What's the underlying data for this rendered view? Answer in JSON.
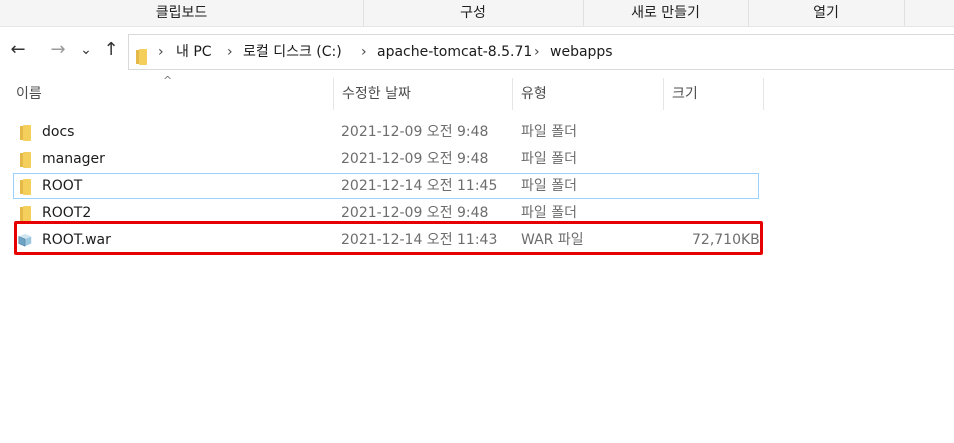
{
  "ribbon": {
    "groups": [
      "클립보드",
      "구성",
      "새로 만들기",
      "열기"
    ]
  },
  "nav": {
    "back_glyph": "←",
    "forward_glyph": "→",
    "history_glyph": "⌄",
    "up_glyph": "↑",
    "breadcrumb": [
      "내 PC",
      "로컬 디스크 (C:)",
      "apache-tomcat-8.5.71",
      "webapps"
    ],
    "separator": "›"
  },
  "columns": {
    "name": "이름",
    "modified": "수정한 날짜",
    "type": "유형",
    "size": "크기",
    "sort_glyph": "^"
  },
  "files": [
    {
      "name": "docs",
      "modified": "2021-12-09 오전 9:48",
      "type": "파일 폴더",
      "size": "",
      "icon": "folder-icon"
    },
    {
      "name": "manager",
      "modified": "2021-12-09 오전 9:48",
      "type": "파일 폴더",
      "size": "",
      "icon": "folder-icon"
    },
    {
      "name": "ROOT",
      "modified": "2021-12-14 오전 11:45",
      "type": "파일 폴더",
      "size": "",
      "icon": "folder-icon"
    },
    {
      "name": "ROOT2",
      "modified": "2021-12-09 오전 9:48",
      "type": "파일 폴더",
      "size": "",
      "icon": "folder-icon"
    },
    {
      "name": "ROOT.war",
      "modified": "2021-12-14 오전 11:43",
      "type": "WAR 파일",
      "size": "72,710KB",
      "icon": "war-file-icon"
    }
  ],
  "colors": {
    "highlight": "#e60000",
    "selection_border": "#99d1ff",
    "folder": "#f4cf5b"
  }
}
